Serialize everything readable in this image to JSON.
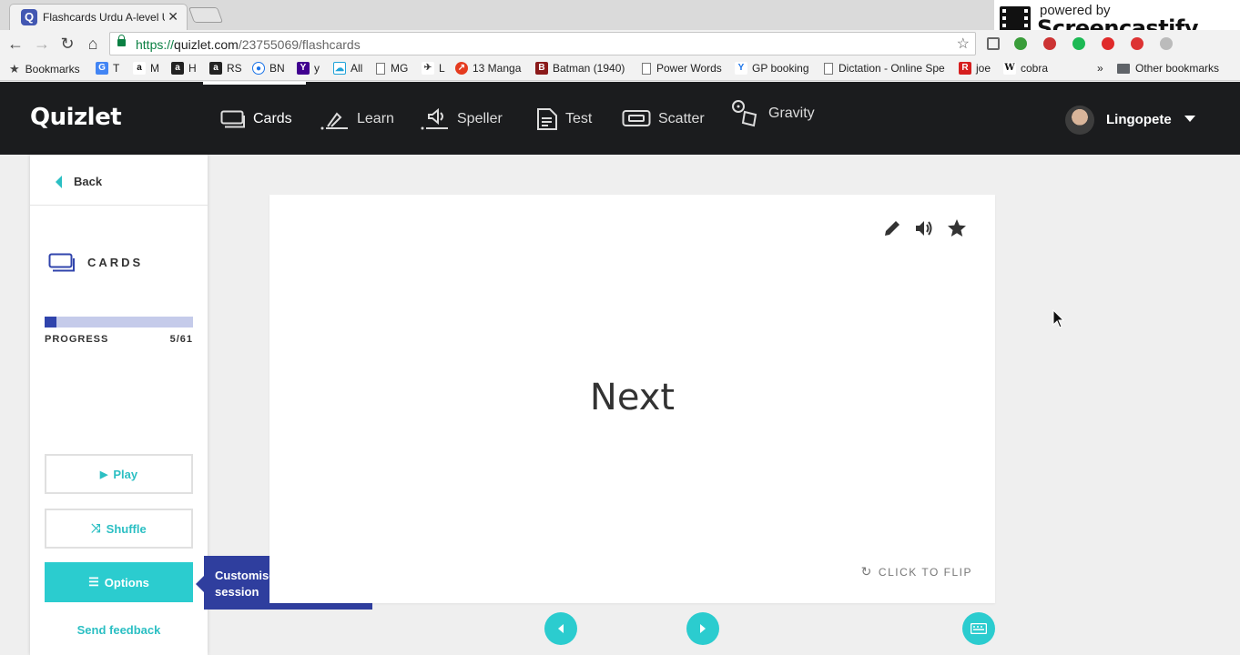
{
  "browser": {
    "tab_title": "Flashcards Urdu A-level U",
    "favicon_letter": "Q",
    "url_https": "https://",
    "url_host": "quizlet.com",
    "url_path": "/23755069/flashcards",
    "bookmarks": [
      {
        "label": "Bookmarks",
        "icon": "star-icon"
      },
      {
        "label": "T",
        "icon": "google-translate-icon"
      },
      {
        "label": "M",
        "icon": "amazon-icon"
      },
      {
        "label": "H",
        "icon": "amazon-icon"
      },
      {
        "label": "RS",
        "icon": "amazon-icon"
      },
      {
        "label": "BN",
        "icon": "location-icon"
      },
      {
        "label": "y",
        "icon": "yahoo-icon"
      },
      {
        "label": "All",
        "icon": "cloud-icon"
      },
      {
        "label": "MG",
        "icon": "page-icon"
      },
      {
        "label": "L",
        "icon": "bird-icon"
      },
      {
        "label": "13 Manga",
        "icon": "manga-icon"
      },
      {
        "label": "Batman (1940)",
        "icon": "batman-icon"
      },
      {
        "label": "Power Words",
        "icon": "page-icon"
      },
      {
        "label": "GP booking",
        "icon": "tick-icon"
      },
      {
        "label": "Dictation - Online Spe",
        "icon": "page-icon"
      },
      {
        "label": "joe",
        "icon": "r-icon"
      },
      {
        "label": "cobra",
        "icon": "wikipedia-icon"
      },
      {
        "label": "»",
        "icon": "chevron-icon"
      },
      {
        "label": "Other bookmarks",
        "icon": "folder-icon"
      }
    ]
  },
  "screencastify": {
    "small": "powered by",
    "big": "Screencastify Lite"
  },
  "header": {
    "logo": "Quizlet",
    "modes": [
      {
        "label": "Cards"
      },
      {
        "label": "Learn"
      },
      {
        "label": "Speller"
      },
      {
        "label": "Test"
      },
      {
        "label": "Scatter"
      },
      {
        "label": "Gravity"
      }
    ],
    "username": "Lingopete"
  },
  "sidebar": {
    "back_label": "Back",
    "section_title": "CARDS",
    "progress_label": "PROGRESS",
    "progress_count": "5/61",
    "progress_fraction": 0.082,
    "play_label": "Play",
    "shuffle_label": "Shuffle",
    "options_label": "Options",
    "feedback_label": "Send feedback"
  },
  "tooltip": {
    "text": "Customise your study session"
  },
  "card": {
    "word": "Next",
    "flip_label": "CLICK TO FLIP"
  },
  "colors": {
    "accent": "#2bcccf",
    "progress": "#3044ac",
    "header": "#1b1c1e"
  }
}
